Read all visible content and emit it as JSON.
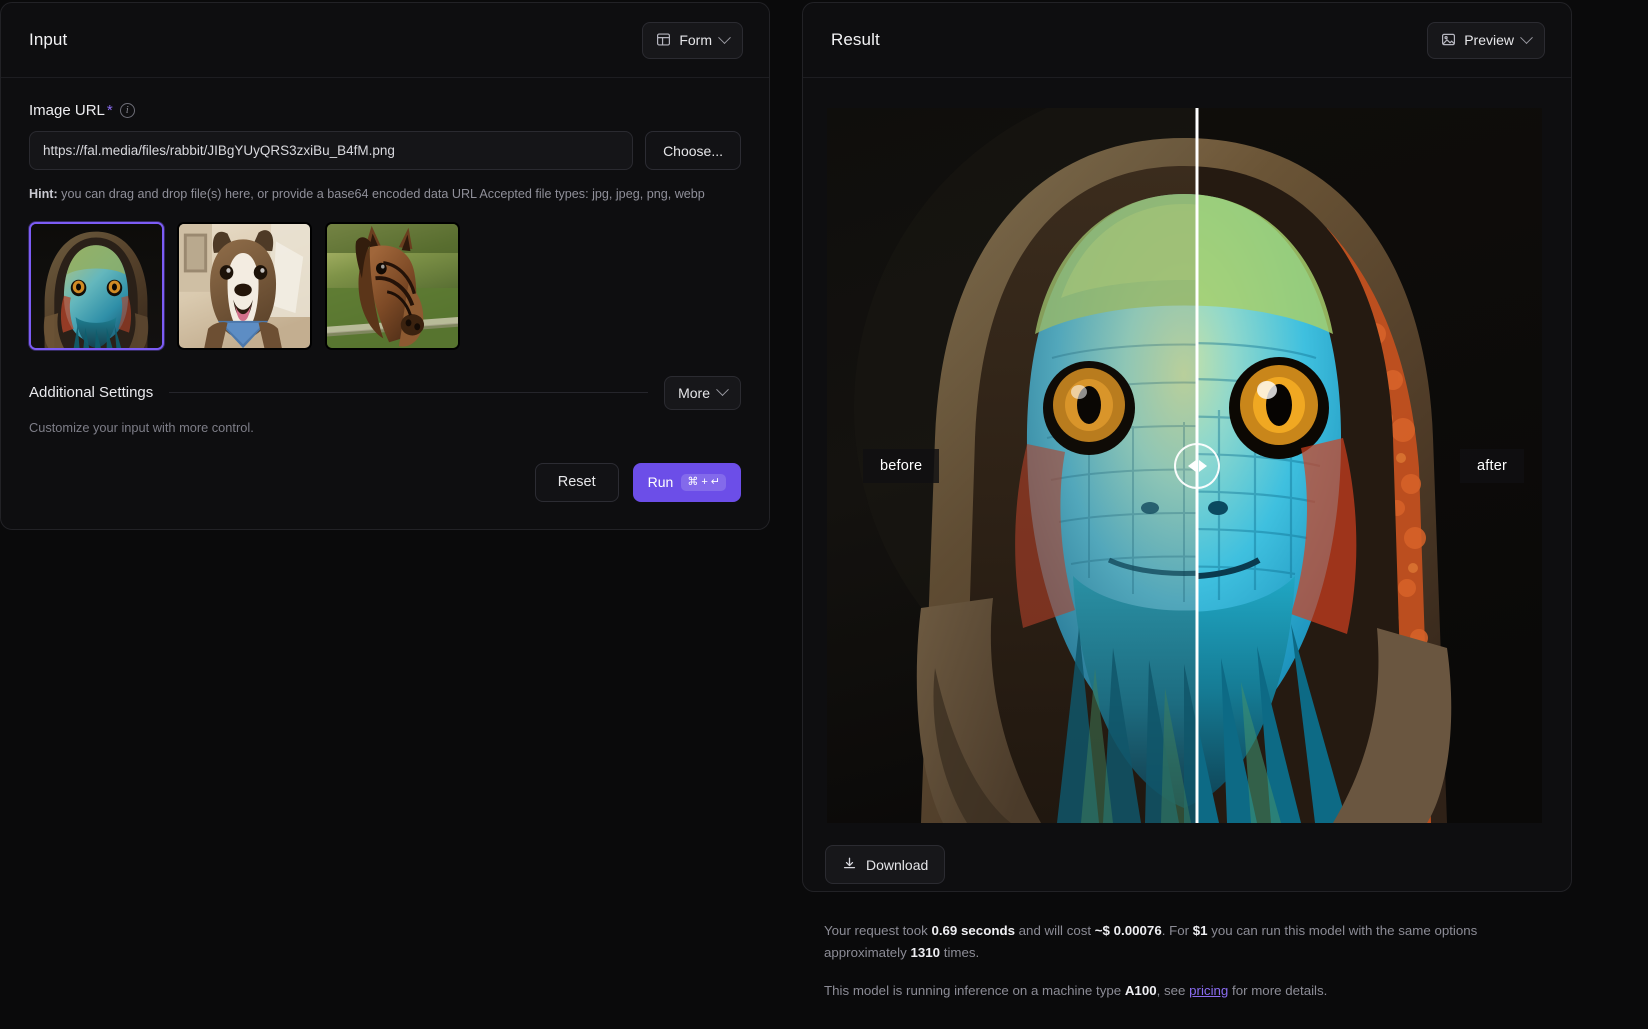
{
  "input": {
    "title": "Input",
    "view_toggle": {
      "label": "Form",
      "icon": "layout-panel-icon"
    },
    "field": {
      "label": "Image URL",
      "required_marker": "*",
      "info_icon": "info-circle-icon",
      "value": "https://fal.media/files/rabbit/JIBgYUyQRS3zxiBu_B4fM.png",
      "placeholder": "https://fal.media/files/rabbit/JIBgYUyQRS3zxiBu_B4fM.png",
      "choose_label": "Choose..."
    },
    "hint": {
      "bold": "Hint:",
      "text": " you can drag and drop file(s) here, or provide a base64 encoded data URL Accepted file types: jpg, jpeg, png, webp"
    },
    "thumbnails": [
      {
        "name": "hooded-lizard-thumbnail",
        "selected": true
      },
      {
        "name": "dog-bandana-thumbnail",
        "selected": false
      },
      {
        "name": "horse-thumbnail",
        "selected": false
      }
    ],
    "additional_settings": {
      "title": "Additional Settings",
      "more_label": "More",
      "description": "Customize your input with more control."
    },
    "actions": {
      "reset_label": "Reset",
      "run_label": "Run",
      "run_shortcut_mod": "⌘",
      "run_shortcut_plus": "+",
      "run_shortcut_key": "↵"
    }
  },
  "result": {
    "title": "Result",
    "view_toggle": {
      "label": "Preview",
      "icon": "image-icon"
    },
    "comparison": {
      "before_label": "before",
      "after_label": "after",
      "divider_position_percent": 51.8,
      "handle_icon": "left-right-arrows-icon"
    },
    "download_label": "Download",
    "download_icon": "download-icon"
  },
  "notes": {
    "line1_a": "Your request took ",
    "duration": "0.69 seconds",
    "line1_b": " and will cost ",
    "cost": "~$ 0.00076",
    "line1_c": ". For ",
    "dollar": "$1",
    "line1_d": " you can run this model with the same options approximately ",
    "runs": "1310",
    "line1_e": " times.",
    "line2_a": "This model is running inference on a machine type ",
    "machine": "A100",
    "line2_b": ", see ",
    "pricing_link": "pricing",
    "line2_c": " for more details."
  },
  "colors": {
    "accent": "#6c4ee8",
    "link": "#8b6df2",
    "panel_bg": "#0e0e10",
    "page_bg": "#0a0a0b",
    "border": "#222226"
  }
}
